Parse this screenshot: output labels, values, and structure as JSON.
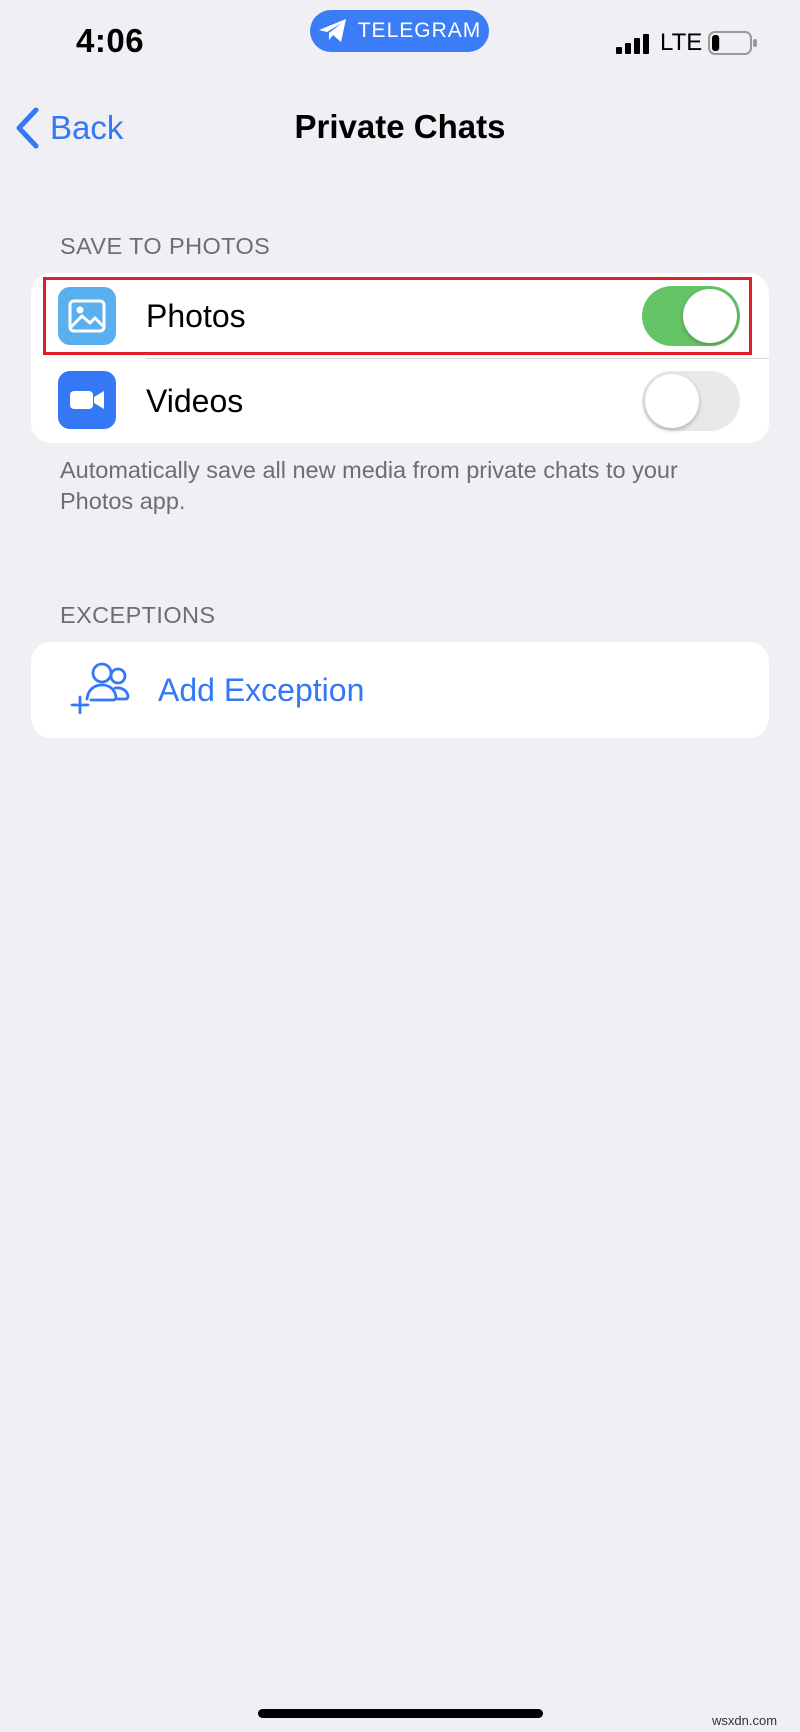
{
  "status_bar": {
    "time": "4:06",
    "app_pill": "TELEGRAM",
    "network": "LTE",
    "battery_level": 0.2
  },
  "nav": {
    "back_label": "Back",
    "title": "Private Chats"
  },
  "save_section": {
    "header": "SAVE TO PHOTOS",
    "rows": [
      {
        "label": "Photos",
        "icon": "photos-icon",
        "icon_color": "#5ab0ef",
        "enabled": true
      },
      {
        "label": "Videos",
        "icon": "video-camera-icon",
        "icon_color": "#3478f6",
        "enabled": false
      }
    ],
    "footer": "Automatically save all new media from private chats to your Photos app."
  },
  "exceptions_section": {
    "header": "EXCEPTIONS",
    "add_label": "Add Exception",
    "icon": "add-users-icon"
  },
  "colors": {
    "accent": "#3478f6",
    "toggle_on": "#65c466",
    "highlight": "#e02029",
    "background": "#efeff4"
  },
  "watermark": "wsxdn.com"
}
